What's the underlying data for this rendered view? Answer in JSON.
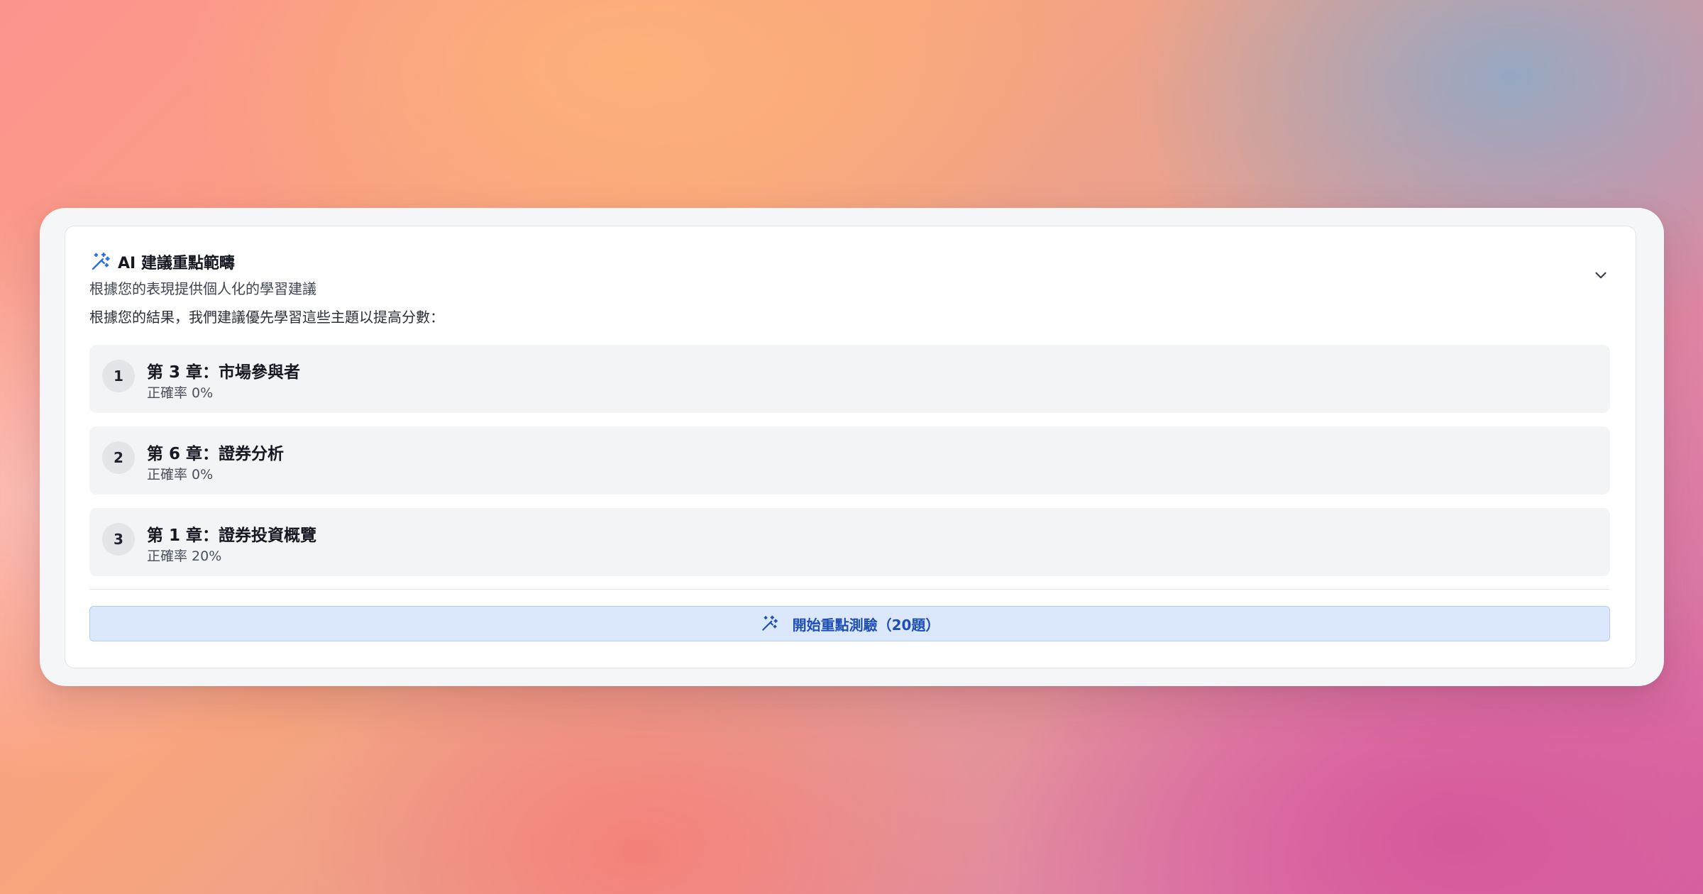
{
  "panel": {
    "title": "AI 建議重點範疇",
    "subtitle": "根據您的表現提供個人化的學習建議",
    "intro": "根據您的結果，我們建議優先學習這些主題以提高分數：",
    "title_icon": "magic-wand-icon",
    "collapse_icon": "chevron-down-icon",
    "topics": [
      {
        "rank": "1",
        "name": "第 3 章：市場參與者",
        "accuracy": "正確率 0%"
      },
      {
        "rank": "2",
        "name": "第 6 章：證券分析",
        "accuracy": "正確率 0%"
      },
      {
        "rank": "3",
        "name": "第 1 章：證券投資概覽",
        "accuracy": "正確率 20%"
      }
    ],
    "start_button": {
      "label": "開始重點測驗（20題）",
      "icon": "magic-wand-icon"
    }
  },
  "colors": {
    "accent": "#1d4fb6",
    "icon_blue": "#2f6fe0",
    "button_bg": "#dbe7fb",
    "topic_bg": "#f3f4f6"
  }
}
